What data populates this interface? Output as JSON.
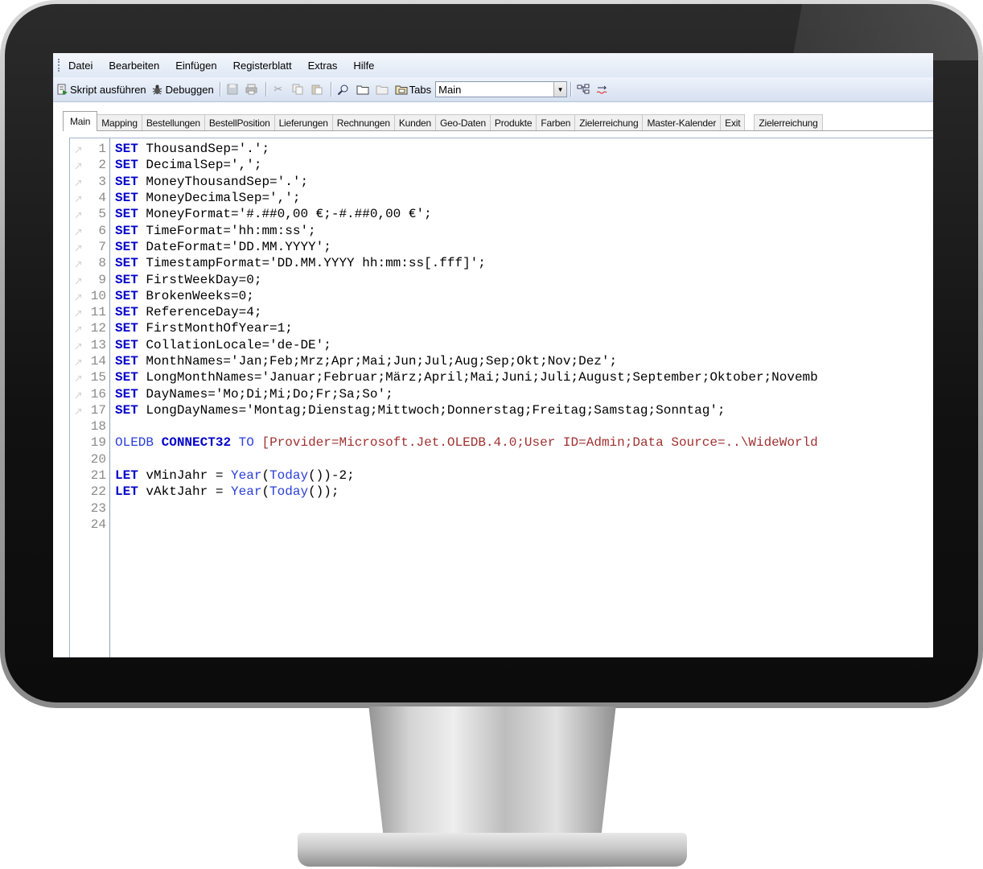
{
  "menu": [
    "Datei",
    "Bearbeiten",
    "Einfügen",
    "Registerblatt",
    "Extras",
    "Hilfe"
  ],
  "toolbar": {
    "run_label": "Skript ausführen",
    "debug_label": "Debuggen",
    "tabs_label": "Tabs",
    "tabs_selected": "Main"
  },
  "tabs": [
    "Main",
    "Mapping",
    "Bestellungen",
    "BestellPosition",
    "Lieferungen",
    "Rechnungen",
    "Kunden",
    "Geo-Daten",
    "Produkte",
    "Farben",
    "Zielerreichung",
    "Master-Kalender",
    "Exit",
    "Zielerreichung"
  ],
  "active_tab": "Main",
  "code_lines": [
    {
      "n": "1",
      "bm": true,
      "parts": [
        [
          "kw",
          "SET"
        ],
        [
          "t",
          " ThousandSep='.';"
        ]
      ]
    },
    {
      "n": "2",
      "bm": true,
      "parts": [
        [
          "kw",
          "SET"
        ],
        [
          "t",
          " DecimalSep=',';"
        ]
      ]
    },
    {
      "n": "3",
      "bm": true,
      "parts": [
        [
          "kw",
          "SET"
        ],
        [
          "t",
          " MoneyThousandSep='.';"
        ]
      ]
    },
    {
      "n": "4",
      "bm": true,
      "parts": [
        [
          "kw",
          "SET"
        ],
        [
          "t",
          " MoneyDecimalSep=',';"
        ]
      ]
    },
    {
      "n": "5",
      "bm": true,
      "parts": [
        [
          "kw",
          "SET"
        ],
        [
          "t",
          " MoneyFormat='#.##0,00 €;-#.##0,00 €';"
        ]
      ]
    },
    {
      "n": "6",
      "bm": true,
      "parts": [
        [
          "kw",
          "SET"
        ],
        [
          "t",
          " TimeFormat='hh:mm:ss';"
        ]
      ]
    },
    {
      "n": "7",
      "bm": true,
      "parts": [
        [
          "kw",
          "SET"
        ],
        [
          "t",
          " DateFormat='DD.MM.YYYY';"
        ]
      ]
    },
    {
      "n": "8",
      "bm": true,
      "parts": [
        [
          "kw",
          "SET"
        ],
        [
          "t",
          " TimestampFormat='DD.MM.YYYY hh:mm:ss[.fff]';"
        ]
      ]
    },
    {
      "n": "9",
      "bm": true,
      "parts": [
        [
          "kw",
          "SET"
        ],
        [
          "t",
          " FirstWeekDay=0;"
        ]
      ]
    },
    {
      "n": "10",
      "bm": true,
      "parts": [
        [
          "kw",
          "SET"
        ],
        [
          "t",
          " BrokenWeeks=0;"
        ]
      ]
    },
    {
      "n": "11",
      "bm": true,
      "parts": [
        [
          "kw",
          "SET"
        ],
        [
          "t",
          " ReferenceDay=4;"
        ]
      ]
    },
    {
      "n": "12",
      "bm": true,
      "parts": [
        [
          "kw",
          "SET"
        ],
        [
          "t",
          " FirstMonthOfYear=1;"
        ]
      ]
    },
    {
      "n": "13",
      "bm": true,
      "parts": [
        [
          "kw",
          "SET"
        ],
        [
          "t",
          " CollationLocale='de-DE';"
        ]
      ]
    },
    {
      "n": "14",
      "bm": true,
      "parts": [
        [
          "kw",
          "SET"
        ],
        [
          "t",
          " MonthNames='Jan;Feb;Mrz;Apr;Mai;Jun;Jul;Aug;Sep;Okt;Nov;Dez';"
        ]
      ]
    },
    {
      "n": "15",
      "bm": true,
      "parts": [
        [
          "kw",
          "SET"
        ],
        [
          "t",
          " LongMonthNames='Januar;Februar;März;April;Mai;Juni;Juli;August;September;Oktober;Novemb"
        ]
      ]
    },
    {
      "n": "16",
      "bm": true,
      "parts": [
        [
          "kw",
          "SET"
        ],
        [
          "t",
          " DayNames='Mo;Di;Mi;Do;Fr;Sa;So';"
        ]
      ]
    },
    {
      "n": "17",
      "bm": true,
      "parts": [
        [
          "kw",
          "SET"
        ],
        [
          "t",
          " LongDayNames='Montag;Dienstag;Mittwoch;Donnerstag;Freitag;Samstag;Sonntag';"
        ]
      ]
    },
    {
      "n": "18",
      "bm": false,
      "parts": []
    },
    {
      "n": "19",
      "bm": false,
      "parts": [
        [
          "fn",
          "OLEDB"
        ],
        [
          "t",
          " "
        ],
        [
          "kw",
          "CONNECT32"
        ],
        [
          "t",
          " "
        ],
        [
          "fn",
          "TO"
        ],
        [
          "t",
          " "
        ],
        [
          "str",
          "[Provider=Microsoft.Jet.OLEDB.4.0;User ID=Admin;Data Source=..\\WideWorld"
        ]
      ]
    },
    {
      "n": "20",
      "bm": false,
      "parts": []
    },
    {
      "n": "21",
      "bm": false,
      "parts": [
        [
          "kw",
          "LET"
        ],
        [
          "t",
          " vMinJahr = "
        ],
        [
          "fn",
          "Year"
        ],
        [
          "t",
          "("
        ],
        [
          "fn",
          "Today"
        ],
        [
          "t",
          "())-2;"
        ]
      ]
    },
    {
      "n": "22",
      "bm": false,
      "parts": [
        [
          "kw",
          "LET"
        ],
        [
          "t",
          " vAktJahr = "
        ],
        [
          "fn",
          "Year"
        ],
        [
          "t",
          "("
        ],
        [
          "fn",
          "Today"
        ],
        [
          "t",
          "());"
        ]
      ]
    },
    {
      "n": "23",
      "bm": false,
      "parts": []
    },
    {
      "n": "24",
      "bm": false,
      "parts": []
    }
  ]
}
